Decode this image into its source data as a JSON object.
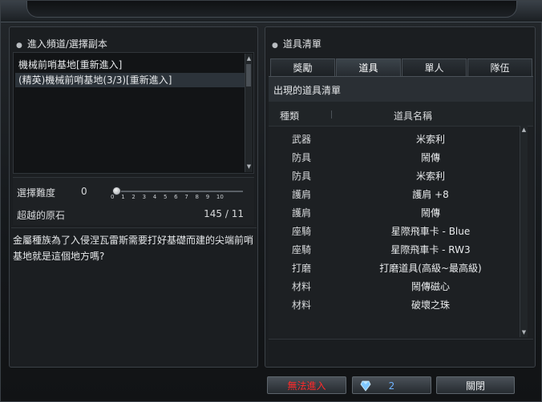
{
  "left_panel": {
    "title": "進入頻道/選擇副本",
    "dungeons": [
      {
        "label": "機械前哨基地[重新進入]"
      },
      {
        "label": "(精英)機械前哨基地(3/3)[重新進入]"
      }
    ],
    "difficulty_label": "選擇難度",
    "difficulty_value": "0",
    "difficulty_ticks": [
      "0",
      "1",
      "2",
      "3",
      "4",
      "5",
      "6",
      "7",
      "8",
      "9",
      "10"
    ],
    "difficulty_level": 0,
    "stone_label": "超越的原石",
    "stone_value": "145 / 11",
    "description": "金屬種族為了入侵涅瓦雷斯需要打好基礎而建的尖端前哨基地就是這個地方嗎?"
  },
  "right_panel": {
    "title": "道具清單",
    "tabs": [
      {
        "label": "獎勵"
      },
      {
        "label": "道具"
      },
      {
        "label": "單人"
      },
      {
        "label": "隊伍"
      }
    ],
    "active_tab": 1,
    "subtitle": "出現的道具清單",
    "columns": [
      "種類",
      "道具名稱"
    ],
    "items": [
      {
        "type": "武器",
        "name": "米索利"
      },
      {
        "type": "防具",
        "name": "鬧傳"
      },
      {
        "type": "防具",
        "name": "米索利"
      },
      {
        "type": "護肩",
        "name": "護肩 +8"
      },
      {
        "type": "護肩",
        "name": "鬧傳"
      },
      {
        "type": "座騎",
        "name": "星際飛車卡 - Blue"
      },
      {
        "type": "座騎",
        "name": "星際飛車卡 - RW3"
      },
      {
        "type": "打磨",
        "name": "打磨道具(高級~最高級)"
      },
      {
        "type": "材料",
        "name": "鬧傳磁心"
      },
      {
        "type": "材料",
        "name": "破壞之珠"
      }
    ]
  },
  "footer": {
    "enter_label": "無法進入",
    "gem_count": "2",
    "close_label": "關閉"
  },
  "colors": {
    "enter_text": "#ff2a2a",
    "gem_count": "#6fb3ff",
    "selected_row": "#2c333a"
  }
}
